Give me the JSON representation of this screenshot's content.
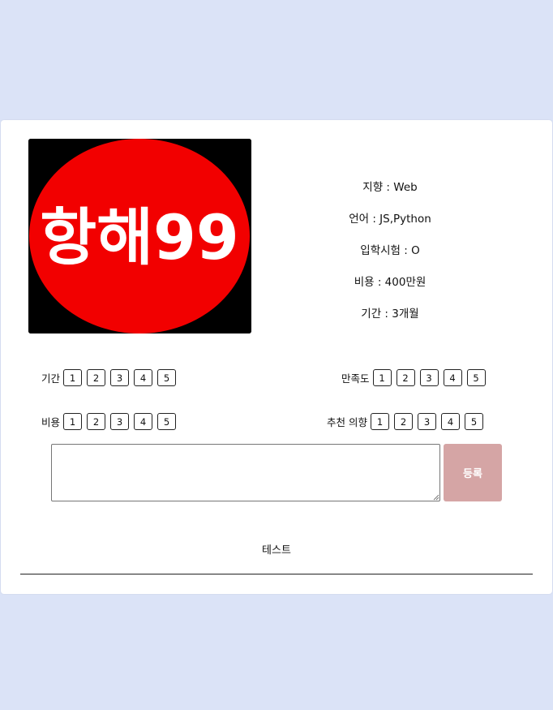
{
  "logo": {
    "text": "항해99",
    "bg_color": "#000000",
    "circle_color": "#f20000"
  },
  "info": {
    "direction": "지향 : Web",
    "language": "언어 : JS,Python",
    "entrance_test": "입학시험 : O",
    "cost": "비용 : 400만원",
    "duration": "기간 : 3개월"
  },
  "ratings": {
    "duration": {
      "label": "기간",
      "options": [
        "1",
        "2",
        "3",
        "4",
        "5"
      ]
    },
    "satisfaction": {
      "label": "만족도",
      "options": [
        "1",
        "2",
        "3",
        "4",
        "5"
      ]
    },
    "cost": {
      "label": "비용",
      "options": [
        "1",
        "2",
        "3",
        "4",
        "5"
      ]
    },
    "recommend": {
      "label": "추천 의향",
      "options": [
        "1",
        "2",
        "3",
        "4",
        "5"
      ]
    }
  },
  "comment": {
    "value": "",
    "submit_label": "등록"
  },
  "comments": [
    {
      "text": "테스트"
    }
  ],
  "colors": {
    "page_bg": "#dbe3f7",
    "submit_bg": "#d5a5a5"
  }
}
